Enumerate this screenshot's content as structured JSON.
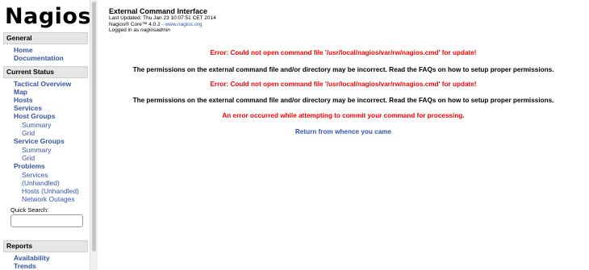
{
  "logo": {
    "text": "Nagios",
    "mark": "®"
  },
  "sidebar": {
    "general": {
      "header": "General",
      "items": [
        "Home",
        "Documentation"
      ]
    },
    "current_status": {
      "header": "Current Status",
      "tactical_overview": "Tactical Overview",
      "map": "Map",
      "hosts": "Hosts",
      "services": "Services",
      "host_groups": "Host Groups",
      "host_groups_summary": "Summary",
      "host_groups_grid": "Grid",
      "service_groups": "Service Groups",
      "service_groups_summary": "Summary",
      "service_groups_grid": "Grid",
      "problems": "Problems",
      "problems_services": "Services",
      "problems_unhandled": "(Unhandled)",
      "problems_hosts": "Hosts",
      "problems_hosts_unhandled": "(Unhandled)",
      "network_outages": "Network Outages"
    },
    "quick_search": {
      "label": "Quick Search:",
      "value": ""
    },
    "reports": {
      "header": "Reports",
      "availability": "Availability",
      "trends": "Trends"
    }
  },
  "main": {
    "title": "External Command Interface",
    "last_updated": "Last Updated: Thu Jan 23 10:07:51 CET 2014",
    "core_version": "Nagios® Core™ 4.0.2 - ",
    "core_link": "www.nagios.org",
    "logged_in_prefix": "Logged in as ",
    "logged_in_user": "nagiosadmin",
    "messages": [
      {
        "kind": "error",
        "text": "Error: Could not open command file '/usr/local/nagios/var/rw/nagios.cmd' for update!"
      },
      {
        "kind": "info",
        "text": "The permissions on the external command file and/or directory may be incorrect. Read the FAQs on how to setup proper permissions."
      },
      {
        "kind": "error",
        "text": "Error: Could not open command file '/usr/local/nagios/var/rw/nagios.cmd' for update!"
      },
      {
        "kind": "info",
        "text": "The permissions on the external command file and/or directory may be incorrect. Read the FAQs on how to setup proper permissions."
      },
      {
        "kind": "error",
        "text": "An error occurred while attempting to commit your command for processing."
      }
    ],
    "return_link": "Return from whence you came"
  },
  "colors": {
    "link": "#3355aa",
    "error": "#ff0000",
    "header_bg": "#e6e6e6"
  }
}
